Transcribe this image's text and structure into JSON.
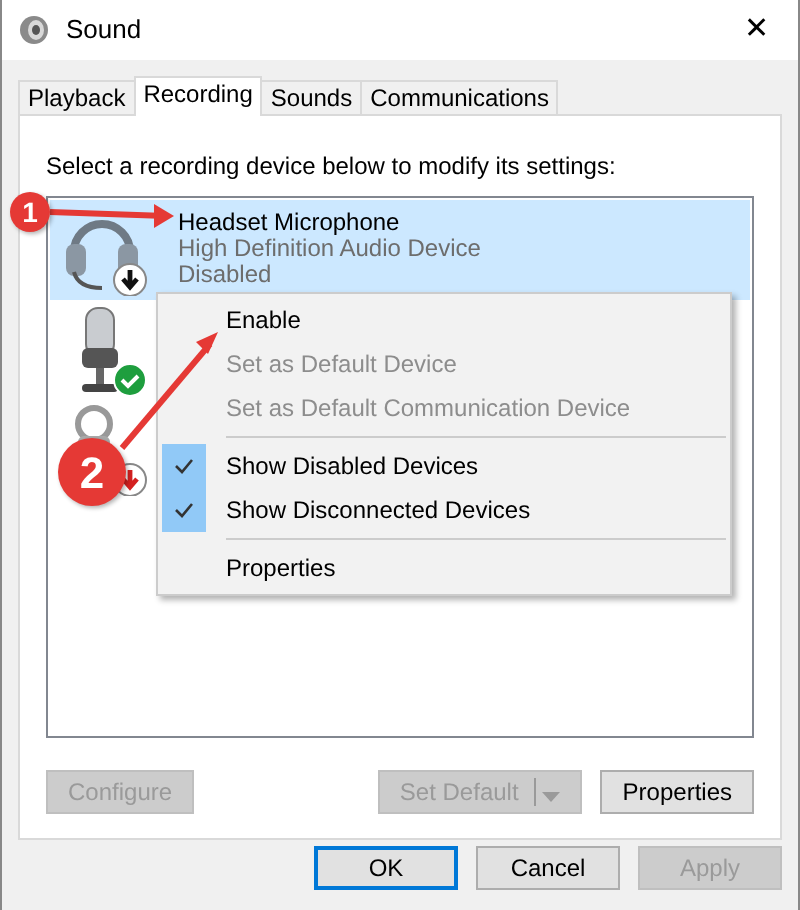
{
  "window": {
    "title": "Sound",
    "close": "✕"
  },
  "tabs": [
    {
      "label": "Playback",
      "selected": false
    },
    {
      "label": "Recording",
      "selected": true
    },
    {
      "label": "Sounds",
      "selected": false
    },
    {
      "label": "Communications",
      "selected": false
    }
  ],
  "instruction": "Select a recording device below to modify its settings:",
  "devices": [
    {
      "kind": "headset",
      "disabled": true,
      "default": false,
      "unplugged": false,
      "selected": true,
      "name": "Headset Microphone",
      "driver": "High Definition Audio Device",
      "state": "Disabled"
    },
    {
      "kind": "microphone",
      "disabled": false,
      "default": true,
      "unplugged": false,
      "selected": false
    },
    {
      "kind": "line",
      "disabled": false,
      "default": false,
      "unplugged": true,
      "selected": false
    }
  ],
  "context_menu": [
    {
      "kind": "item",
      "label": "Enable",
      "disabled": false,
      "checked": false
    },
    {
      "kind": "item",
      "label": "Set as Default Device",
      "disabled": true,
      "checked": false
    },
    {
      "kind": "item",
      "label": "Set as Default Communication Device",
      "disabled": true,
      "checked": false
    },
    {
      "kind": "separator"
    },
    {
      "kind": "item",
      "label": "Show Disabled Devices",
      "disabled": false,
      "checked": true
    },
    {
      "kind": "item",
      "label": "Show Disconnected Devices",
      "disabled": false,
      "checked": true
    },
    {
      "kind": "separator"
    },
    {
      "kind": "item",
      "label": "Properties",
      "disabled": false,
      "checked": false
    }
  ],
  "panel_buttons": [
    {
      "kind": "plain",
      "label": "Configure",
      "disabled": true
    },
    {
      "kind": "split",
      "label": "Set Default",
      "disabled": true
    },
    {
      "kind": "plain",
      "label": "Properties",
      "disabled": false
    }
  ],
  "dialog_buttons": [
    {
      "label": "OK",
      "disabled": false,
      "default": true
    },
    {
      "label": "Cancel",
      "disabled": false,
      "default": false
    },
    {
      "label": "Apply",
      "disabled": true,
      "default": false
    }
  ],
  "annotations": [
    {
      "label": "1"
    },
    {
      "label": "2"
    }
  ]
}
